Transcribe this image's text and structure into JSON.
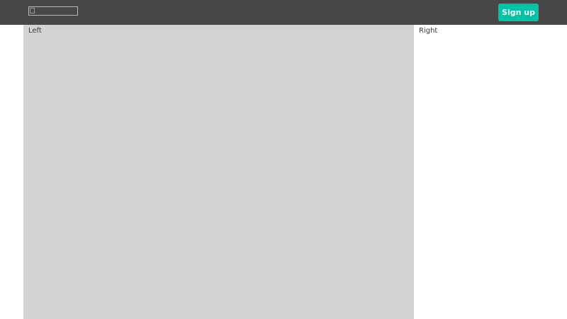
{
  "header": {
    "signup_label": "Sign up",
    "accent_color": "#00c4a7",
    "background_color": "#474747"
  },
  "columns": {
    "left_label": "Left",
    "right_label": "Right",
    "left_background": "#d3d3d3"
  }
}
